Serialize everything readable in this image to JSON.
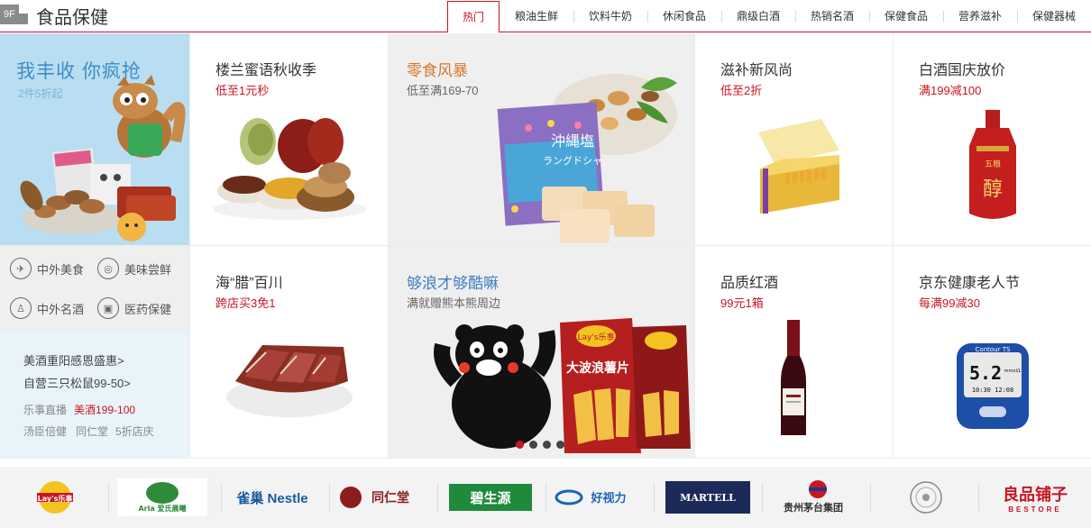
{
  "header": {
    "floor_number": "9F",
    "title": "食品保健",
    "tabs": [
      "热门",
      "粮油生鲜",
      "饮料牛奶",
      "休闲食品",
      "鼎级白酒",
      "热销名酒",
      "保健食品",
      "营养滋补",
      "保健器械"
    ],
    "active_tab": 0
  },
  "left_panel": {
    "promo_title": "我丰收 你疯抢",
    "promo_subtitle": "2件5折起",
    "categories": [
      {
        "label": "中外美食",
        "icon": "plane-icon"
      },
      {
        "label": "美味尝鲜",
        "icon": "fish-icon"
      },
      {
        "label": "中外名酒",
        "icon": "bottle-icon"
      },
      {
        "label": "医药保健",
        "icon": "medicine-icon"
      }
    ],
    "links": [
      "美酒重阳感恩盛惠>",
      "自营三只松鼠99-50>"
    ],
    "tags": [
      {
        "text": "乐事直播",
        "highlight": false
      },
      {
        "text": "美酒199-100",
        "highlight": true
      },
      {
        "text": "汤臣倍健",
        "highlight": false
      },
      {
        "text": "同仁堂",
        "highlight": false
      },
      {
        "text": "5折店庆",
        "highlight": false
      }
    ]
  },
  "cells": {
    "c1": {
      "title": "楼兰蜜语秋收季",
      "sub": "低至1元秒"
    },
    "c2": {
      "title": "零食风暴",
      "sub": "低至满169-70",
      "pack_text_1": "沖縄塩",
      "pack_text_2": "ラングドシャ"
    },
    "c3": {
      "title": "滋补新风尚",
      "sub": "低至2折"
    },
    "c4": {
      "title": "白酒国庆放价",
      "sub": "满199减100",
      "bottle_text": "醇",
      "bottle_brand": "五粮"
    },
    "c5": {
      "title": "海“腊”百川",
      "sub": "跨店买3免1"
    },
    "c6": {
      "title": "够浪才够酷嘛",
      "sub": "满就赠熊本熊周边",
      "bag_brand": "Lay's乐事",
      "bag_text": "大波浪薯片"
    },
    "c7": {
      "title": "品质红酒",
      "sub": "99元1箱"
    },
    "c8": {
      "title": "京东健康老人节",
      "sub": "每满99减30",
      "meter_brand": "Contour TS",
      "meter_value": "5.2",
      "meter_unit": "mmol/L",
      "meter_time": "10:30 12:08"
    }
  },
  "carousel": {
    "count": 4,
    "active": 0
  },
  "brands": [
    {
      "name": "Lay's乐事",
      "color": "#c81623"
    },
    {
      "name": "Arla 爱氏晨曦",
      "color": "#2f8b3a"
    },
    {
      "name": "雀巢 Nestle",
      "color": "#1a5a9e"
    },
    {
      "name": "同仁堂",
      "color": "#8b1d1d"
    },
    {
      "name": "碧生源",
      "color": "#fff"
    },
    {
      "name": "好视力",
      "color": "#1a63b8"
    },
    {
      "name": "MARTELL",
      "color": "#fff"
    },
    {
      "name": "贵州茅台集团",
      "color": "#333"
    },
    {
      "name": "品牌徽章",
      "color": "#888"
    },
    {
      "name": "良品铺子",
      "color": "#c81623"
    }
  ],
  "brand_sub": {
    "bestore": "BESTORE"
  },
  "colors": {
    "accent": "#c81623",
    "promo_blue": "#3f8dc6"
  }
}
